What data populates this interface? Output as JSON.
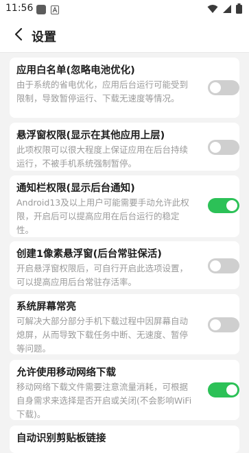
{
  "status_bar": {
    "time": "11:56",
    "icons": [
      "app-square-icon",
      "a-notification-icon",
      "wifi-icon",
      "signal-icon",
      "battery-icon"
    ]
  },
  "header": {
    "back_icon": "chevron-left-icon",
    "title": "设置"
  },
  "settings": [
    {
      "title": "应用白名单(忽略电池优化)",
      "description": "由于系统的省电优化，应用后台运行可能受到限制，导致暂停运行、下载无速度等情况。",
      "enabled": false
    },
    {
      "title": "悬浮窗权限(显示在其他应用上层)",
      "description": "此项权限可以很大程度上保证应用在后台持续运行，不被手机系统强制暂停。",
      "enabled": false
    },
    {
      "title": "通知栏权限(显示后台通知)",
      "description": "Android13及以上用户可能需要手动允许此权限，开启后可以提高应用在后台运行的稳定性。",
      "enabled": true
    },
    {
      "title": "创建1像素悬浮窗(后台常驻保活)",
      "description": "开启悬浮窗权限后，可自行开启此选项设置，可以提高应用后台常驻存活率。",
      "enabled": false
    },
    {
      "title": "系统屏幕常亮",
      "description": "可解决大部分部分手机下载过程中因屏幕自动熄屏，从而导致下载任务中断、无速度、暂停等问题。",
      "enabled": false
    },
    {
      "title": "允许使用移动网络下载",
      "description": "移动网络下载文件需要注意流量消耗，可根据自身需求来选择是否开启或关闭(不会影响WiFi下载)。",
      "enabled": true
    },
    {
      "title": "自动识别剪贴板链接",
      "description": "",
      "enabled": null
    }
  ],
  "colors": {
    "toggle_on": "#2cc157",
    "toggle_off": "#cfcfcf"
  }
}
